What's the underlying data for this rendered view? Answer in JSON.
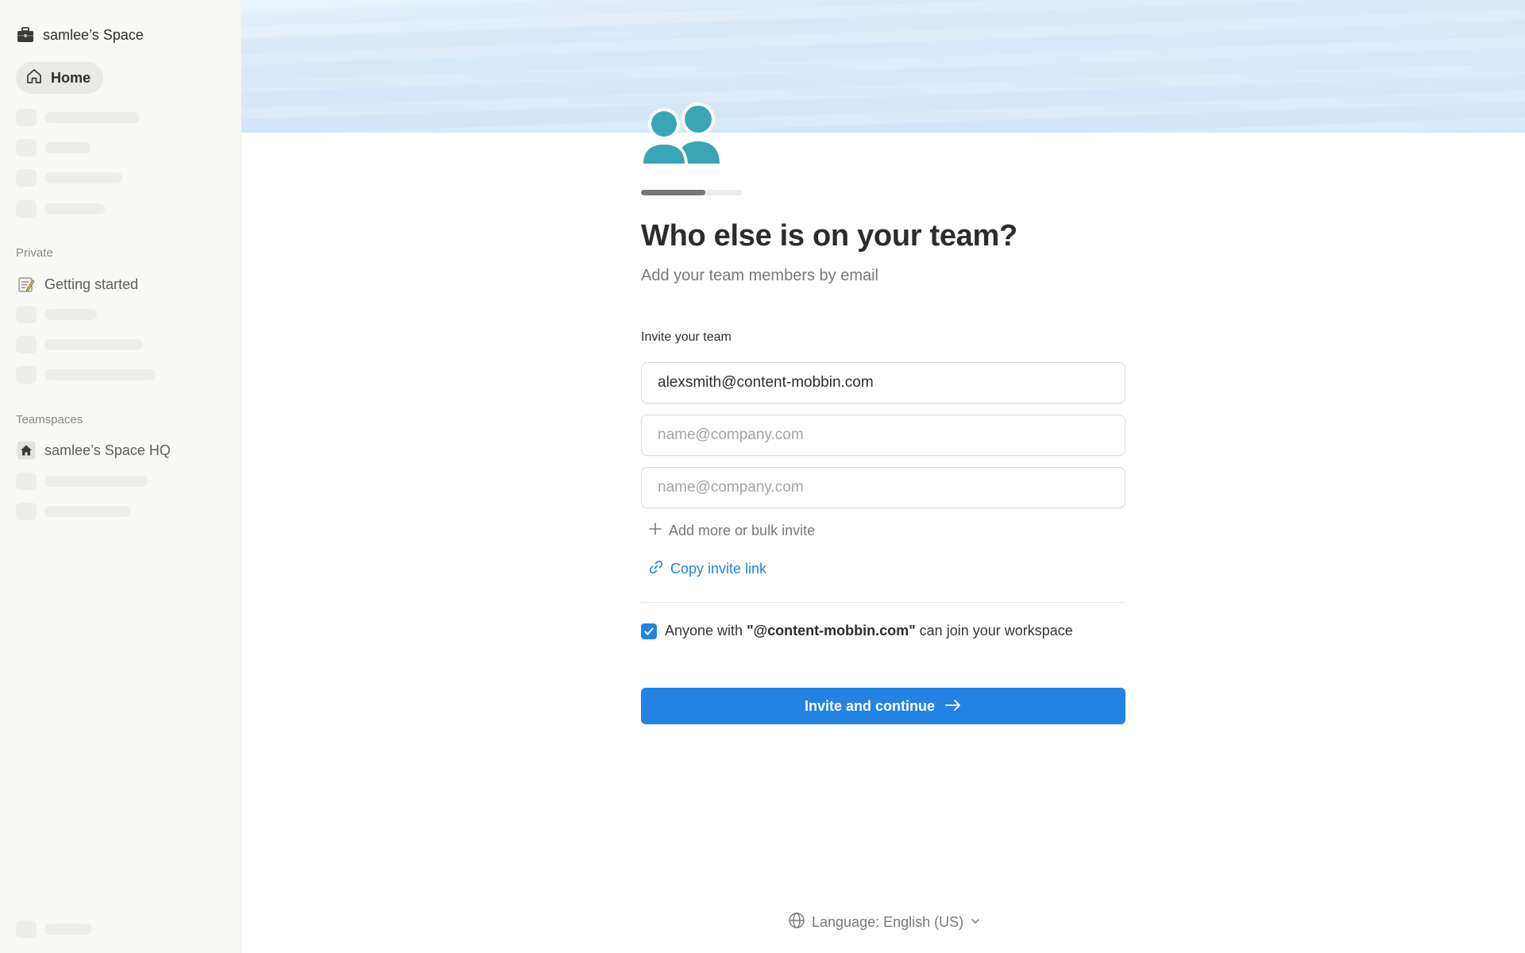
{
  "sidebar": {
    "workspace_name": "samlee’s Space",
    "home_label": "Home",
    "private_section_label": "Private",
    "private_item_label": "Getting started",
    "teamspaces_section_label": "Teamspaces",
    "teamspace_item_label": "samlee’s Space HQ"
  },
  "onboarding": {
    "progress": 0.63,
    "title": "Who else is on your team?",
    "subtitle": "Add your team members by email",
    "invite_label": "Invite your team",
    "email_1_value": "alexsmith@content-mobbin.com",
    "email_placeholder": "name@company.com",
    "add_more_label": "Add more or bulk invite",
    "copy_link_label": "Copy invite link",
    "domain_checkbox_checked": true,
    "domain_text_prefix": "Anyone with ",
    "domain_text_domain": "\"@content-mobbin.com\"",
    "domain_text_suffix": " can join your workspace",
    "cta_label": "Invite and continue"
  },
  "footer": {
    "language_label": "Language: English (US)"
  },
  "colors": {
    "accent": "#2383e2",
    "team_icon": "#3aa5b5",
    "banner": "#d6e8f9"
  },
  "icons": {
    "workspace": "briefcase-icon",
    "home": "home-icon",
    "getting_started": "notepad-icon",
    "teamspace": "house-icon",
    "team": "people-icon",
    "add": "plus-icon",
    "copy": "link-icon",
    "checkbox": "checkmark-icon",
    "cta": "arrow-right-icon",
    "language": "globe-icon",
    "language_dropdown": "chevron-down-icon"
  }
}
